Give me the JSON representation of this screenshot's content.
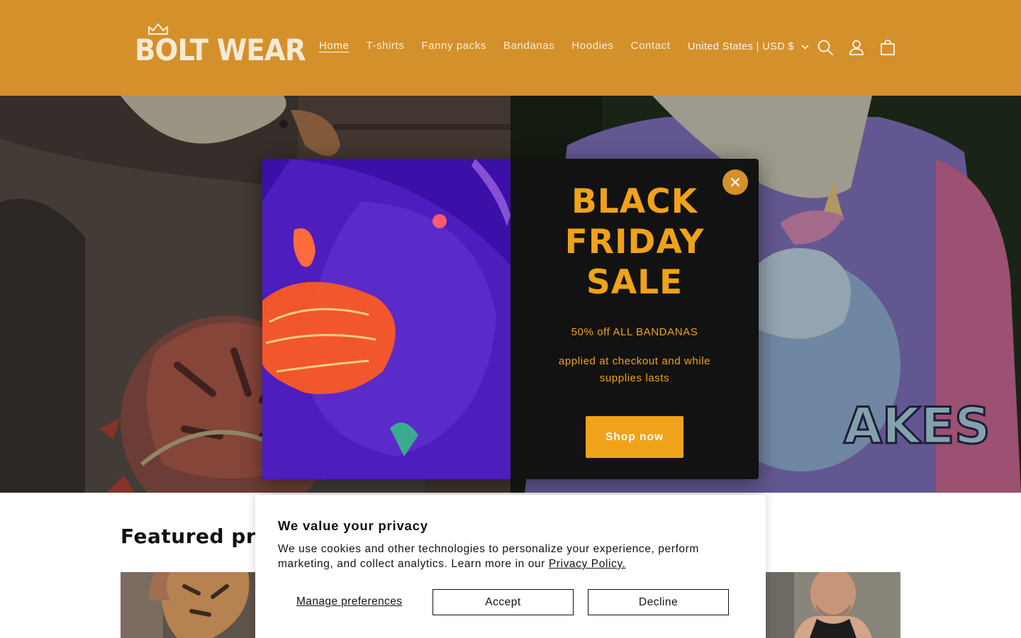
{
  "brand": {
    "logo_text": "BOLT WEAR",
    "logo_color": "#f6ead5"
  },
  "colors": {
    "header_bg": "#d4902b",
    "accent": "#f0a21a",
    "modal_bg": "#121212"
  },
  "header": {
    "nav": [
      {
        "label": "Home",
        "active": true
      },
      {
        "label": "T-shirts"
      },
      {
        "label": "Fanny packs"
      },
      {
        "label": "Bandanas"
      },
      {
        "label": "Hoodies"
      },
      {
        "label": "Contact"
      }
    ],
    "currency": "United States | USD $",
    "icons": [
      "search-icon",
      "account-icon",
      "cart-icon"
    ]
  },
  "modal": {
    "title": "BLACK\nFRIDAY\nSALE",
    "offer": "50% off ALL BANDANAS",
    "note": "applied at checkout and while supplies lasts",
    "button": "Shop now",
    "close_icon": "close-icon"
  },
  "featured": {
    "title": "Featured pro"
  },
  "cookie": {
    "title": "We value your privacy",
    "text": "We use cookies and other technologies to personalize your experience, perform marketing, and collect analytics. Learn more in our",
    "link": "Privacy Policy.",
    "manage": "Manage preferences",
    "accept": "Accept",
    "decline": "Decline"
  }
}
